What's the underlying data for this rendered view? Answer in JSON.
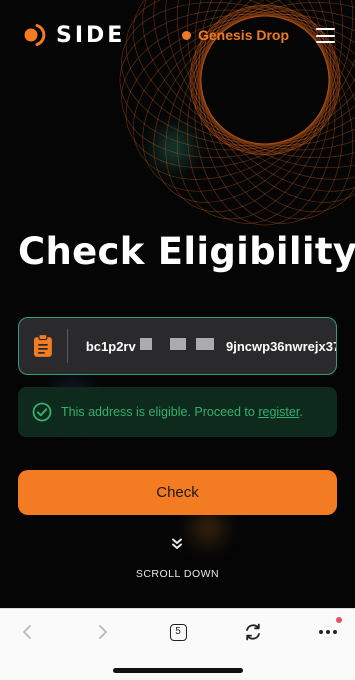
{
  "header": {
    "logo_text": "SIDE",
    "genesis_label": "Genesis Drop",
    "menu_icon": "hamburger-menu-icon"
  },
  "main": {
    "title": "Check Eligibility",
    "address_input": {
      "value": "bc1p2rv                         9jncwp36nwrejx37",
      "icon": "clipboard-paste-icon"
    },
    "notice": {
      "text": "This address is eligible. Proceed to ",
      "link_label": "register",
      "suffix": ".",
      "icon": "check-circle-icon"
    },
    "check_button_label": "Check",
    "scroll_label": "SCROLL DOWN",
    "scroll_icon": "double-chevron-down-icon"
  },
  "browser_toolbar": {
    "tab_count": "5",
    "icons": [
      "back-arrow-icon",
      "forward-arrow-icon",
      "tabs-icon",
      "reload-icon",
      "more-icon"
    ]
  },
  "colors": {
    "accent_orange": "#f37b22",
    "success_green": "#33b06c",
    "notice_bg": "#0e2a1c",
    "input_border": "#2e9e74"
  }
}
